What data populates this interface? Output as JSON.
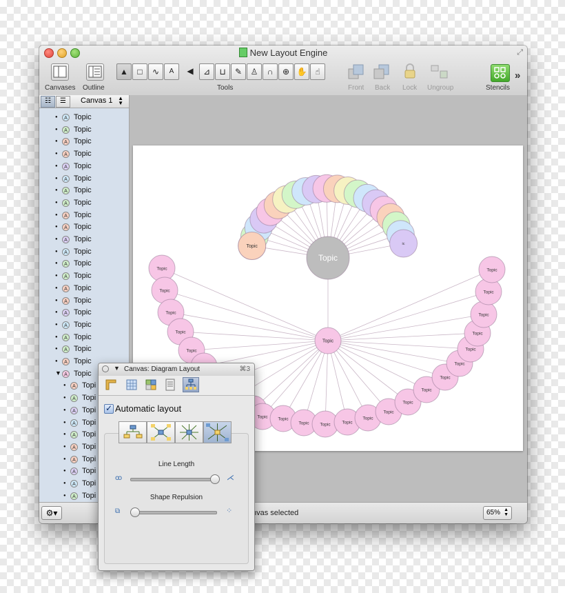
{
  "window": {
    "title": "New Layout Engine",
    "fullscreen_glyph": "⤢"
  },
  "toolbar": {
    "canvases": "Canvases",
    "outline": "Outline",
    "tools": "Tools",
    "front": "Front",
    "back": "Back",
    "lock": "Lock",
    "ungroup": "Ungroup",
    "stencils": "Stencils",
    "more": "»"
  },
  "sidebar": {
    "canvas_select": "Canvas 1",
    "items": [
      {
        "label": "Topic",
        "color": "#cde8f8"
      },
      {
        "label": "Topic",
        "color": "#cfeec9"
      },
      {
        "label": "Topic",
        "color": "#f8d0c2"
      },
      {
        "label": "Topic",
        "color": "#f8d0c2"
      },
      {
        "label": "Topic",
        "color": "#dcd0f5"
      },
      {
        "label": "Topic",
        "color": "#cde8f8"
      },
      {
        "label": "Topic",
        "color": "#cfeec9"
      },
      {
        "label": "Topic",
        "color": "#cfeec9"
      },
      {
        "label": "Topic",
        "color": "#f8d0c2"
      },
      {
        "label": "Topic",
        "color": "#f8d0c2"
      },
      {
        "label": "Topic",
        "color": "#dcd0f5"
      },
      {
        "label": "Topic",
        "color": "#cde8f8"
      },
      {
        "label": "Topic",
        "color": "#cfeec9"
      },
      {
        "label": "Topic",
        "color": "#cfeec9"
      },
      {
        "label": "Topic",
        "color": "#f8d0c2"
      },
      {
        "label": "Topic",
        "color": "#f8d0c2"
      },
      {
        "label": "Topic",
        "color": "#dcd0f5"
      },
      {
        "label": "Topic",
        "color": "#cde8f8"
      },
      {
        "label": "Topic",
        "color": "#cfeec9"
      },
      {
        "label": "Topic",
        "color": "#cfeec9"
      },
      {
        "label": "Topic",
        "color": "#f8d0c2"
      }
    ],
    "expanded": {
      "label": "Topic",
      "color": "#f6c9e4"
    },
    "children": [
      "Topi",
      "Topi",
      "Topi",
      "Topi",
      "Topi",
      "Topi",
      "Topi",
      "Topi",
      "Topi",
      "Topi"
    ],
    "badge_letter": "A"
  },
  "status": {
    "text": "nvas selected",
    "zoom": "65%"
  },
  "inspector": {
    "title": "Canvas: Diagram Layout",
    "shortcut": "⌘3",
    "automatic_layout": "Automatic layout",
    "automatic_layout_checked": true,
    "line_length": "Line Length",
    "line_length_value": 1.0,
    "shape_repulsion": "Shape Repulsion",
    "shape_repulsion_value": 0.0
  },
  "diagram": {
    "upper_center_label": "Topic",
    "lower_center_label": "Topic",
    "node_label": "Topic",
    "arc_label_fragment": "ic",
    "colors": {
      "pink": "#f7c6e6",
      "gray": "#bdbdbd",
      "peach": "#fad2bc",
      "green": "#d3f6c8",
      "blue": "#cfe6fb",
      "lavender": "#d9c9f5",
      "yellow": "#f6f2c2"
    }
  }
}
